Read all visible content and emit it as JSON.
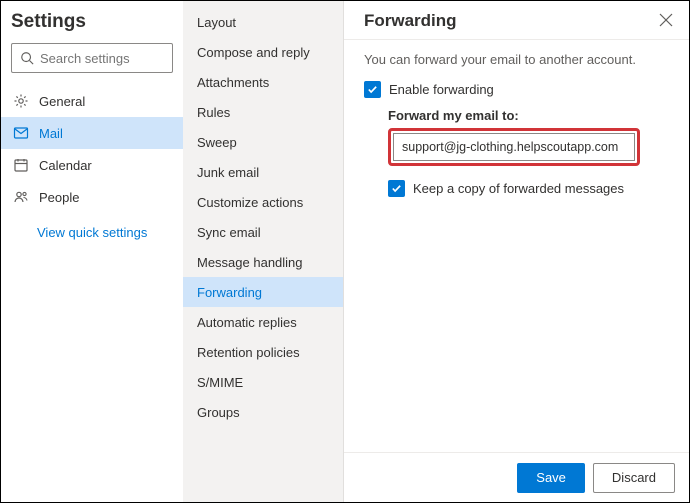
{
  "title": "Settings",
  "search": {
    "placeholder": "Search settings"
  },
  "nav": {
    "general": "General",
    "mail": "Mail",
    "calendar": "Calendar",
    "people": "People",
    "quick": "View quick settings"
  },
  "mid": {
    "items": [
      "Layout",
      "Compose and reply",
      "Attachments",
      "Rules",
      "Sweep",
      "Junk email",
      "Customize actions",
      "Sync email",
      "Message handling",
      "Forwarding",
      "Automatic replies",
      "Retention policies",
      "S/MIME",
      "Groups"
    ],
    "activeIndex": 9
  },
  "panel": {
    "title": "Forwarding",
    "desc": "You can forward your email to another account.",
    "enable": "Enable forwarding",
    "fieldLabel": "Forward my email to:",
    "email": "support@jg-clothing.helpscoutapp.com",
    "keepCopy": "Keep a copy of forwarded messages",
    "save": "Save",
    "discard": "Discard"
  },
  "colors": {
    "accent": "#0078d4",
    "highlight": "#d13438"
  }
}
